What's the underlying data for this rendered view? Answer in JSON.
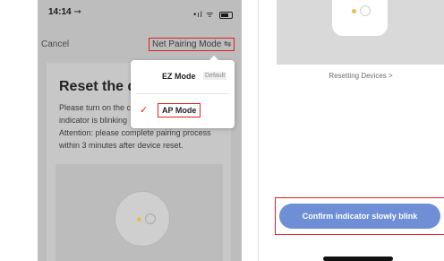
{
  "left": {
    "status": {
      "time": "14:14 ⇾",
      "icons": "•ıl ᯤ"
    },
    "nav": {
      "cancel": "Cancel",
      "net_pairing_mode": "Net Pairing Mode ⇋"
    },
    "card": {
      "title": "Reset the de",
      "line1": "Please turn on the c",
      "line2": "indicator is blinking",
      "line3": "Attention: please complete pairing process",
      "line4": "within 3 minutes after device reset."
    },
    "dropdown": {
      "ez_mode": "EZ Mode",
      "ez_default": "Default",
      "check": "✓",
      "ap_mode": "AP Mode"
    }
  },
  "right": {
    "resetting_link": "Resetting Devices >",
    "confirm_button": "Confirm indicator slowly blink"
  },
  "colors": {
    "highlight": "#e02020",
    "accent": "#6e8fd6",
    "dim": "#bdbdbd"
  }
}
